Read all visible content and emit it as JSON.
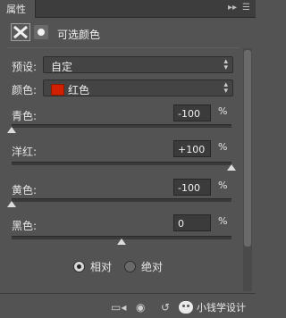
{
  "panel": {
    "tab_label": "属性",
    "title": "可选颜色"
  },
  "preset": {
    "label": "预设:",
    "value": "自定"
  },
  "colors": {
    "label": "颜色:",
    "value": "红色",
    "swatch_color": "#d12000"
  },
  "sliders": [
    {
      "label": "青色:",
      "value": "-100",
      "unit": "%",
      "level": 0.0
    },
    {
      "label": "洋红:",
      "value": "+100",
      "unit": "%",
      "level": 1.0
    },
    {
      "label": "黄色:",
      "value": "-100",
      "unit": "%",
      "level": 0.0
    },
    {
      "label": "黑色:",
      "value": "0",
      "unit": "%",
      "level": 0.5
    }
  ],
  "method": {
    "relative": "相对",
    "absolute": "绝对",
    "selected": "relative"
  },
  "watermark": "小钱学设计"
}
